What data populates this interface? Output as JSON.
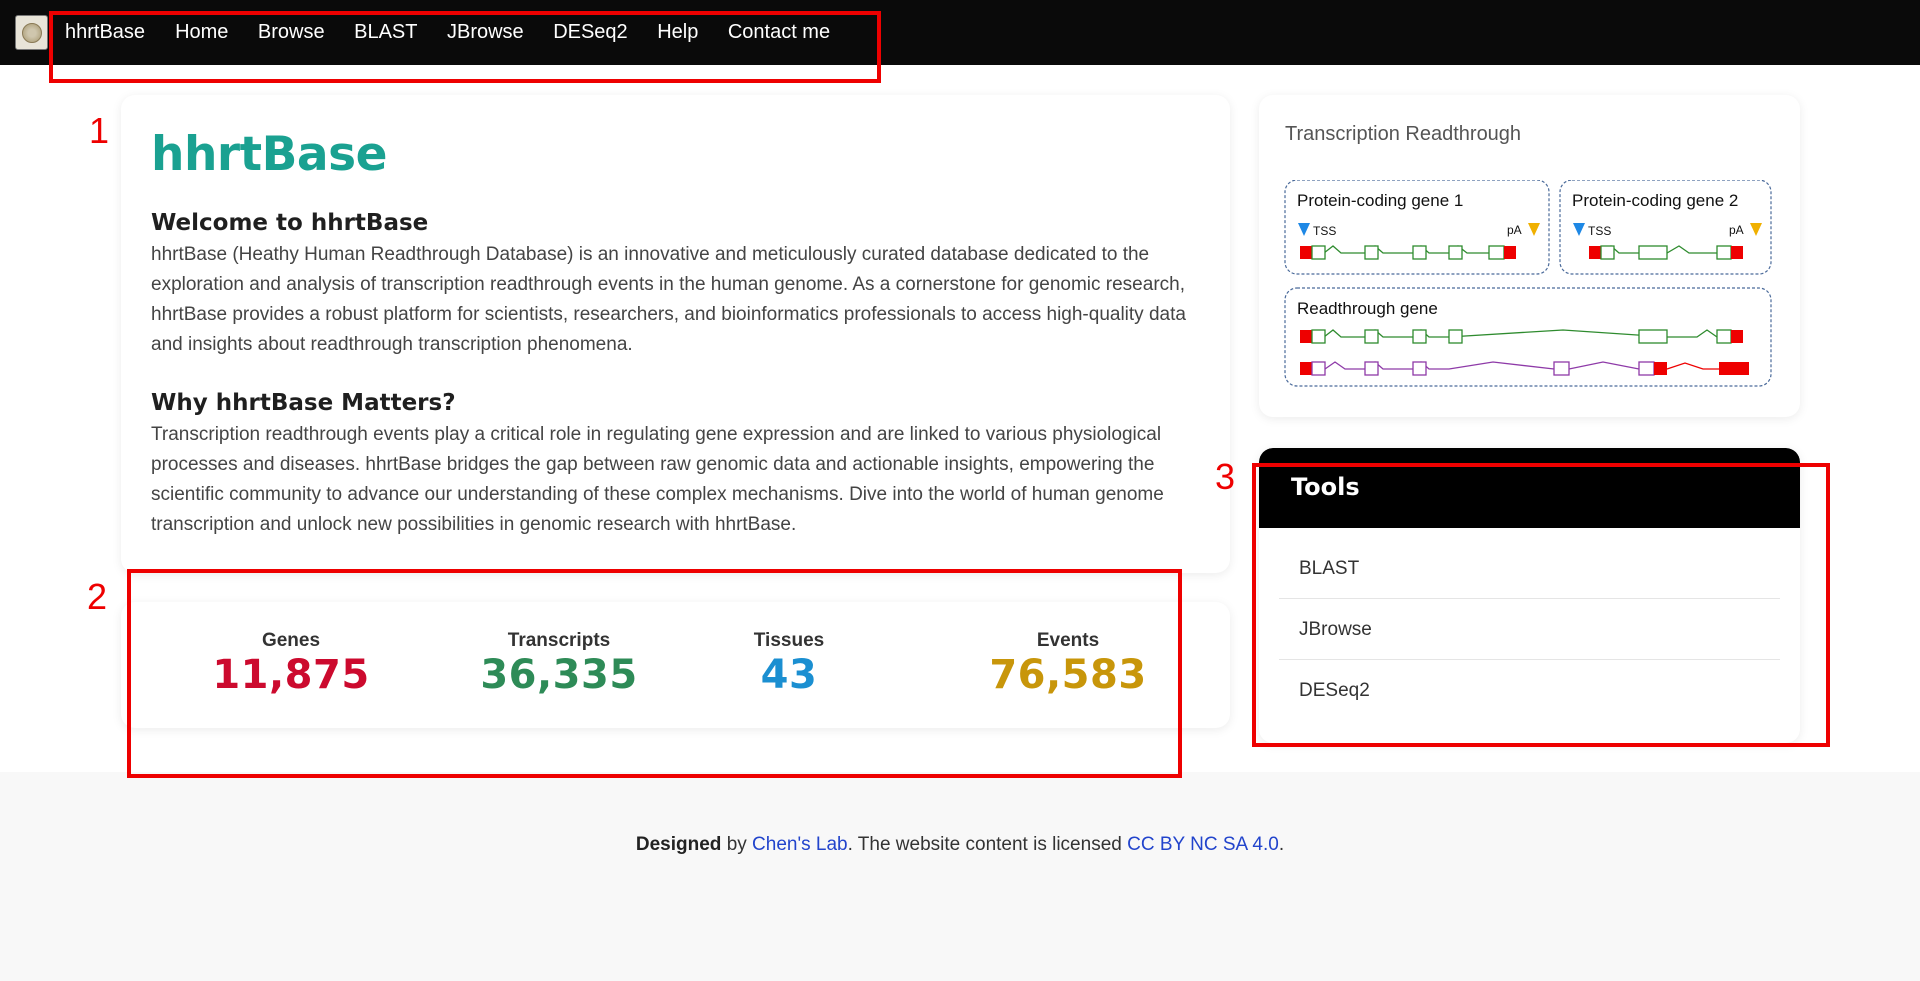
{
  "nav": {
    "logo_icon": "institution-emblem-icon",
    "items": [
      "hhrtBase",
      "Home",
      "Browse",
      "BLAST",
      "JBrowse",
      "DESeq2",
      "Help",
      "Contact me"
    ]
  },
  "annotations": [
    "1",
    "2",
    "3"
  ],
  "intro": {
    "title": "hhrtBase",
    "welcome_heading": "Welcome to hhrtBase",
    "welcome_text": "hhrtBase (Heathy Human Readthrough Database) is an innovative and meticulously curated database dedicated to the exploration and analysis of transcription readthrough events in the human genome. As a cornerstone for genomic research, hhrtBase provides a robust platform for scientists, researchers, and bioinformatics professionals to access high-quality data and insights about readthrough transcription phenomena.",
    "why_heading": "Why hhrtBase Matters?",
    "why_text": "Transcription readthrough events play a critical role in regulating gene expression and are linked to various physiological processes and diseases. hhrtBase bridges the gap between raw genomic data and actionable insights, empowering the scientific community to advance our understanding of these complex mechanisms. Dive into the world of human genome transcription and unlock new possibilities in genomic research with hhrtBase."
  },
  "stats": [
    {
      "label": "Genes",
      "value": "11,875",
      "color": "#cc0a2e"
    },
    {
      "label": "Transcripts",
      "value": "36,335",
      "color": "#2e8b57"
    },
    {
      "label": "Tissues",
      "value": "43",
      "color": "#1b8fd1"
    },
    {
      "label": "Events",
      "value": "76,583",
      "color": "#c8960a"
    }
  ],
  "diagram": {
    "title": "Transcription Readthrough",
    "gene1_label": "Protein-coding gene 1",
    "gene2_label": "Protein-coding gene 2",
    "readthrough_label": "Readthrough gene",
    "tss_label": "TSS",
    "pa_label": "pA"
  },
  "tools": {
    "heading": "Tools",
    "items": [
      "BLAST",
      "JBrowse",
      "DESeq2"
    ]
  },
  "footer": {
    "designed": "Designed",
    "by": " by ",
    "lab_link": "Chen's Lab",
    "license_text": ". The website content is licensed ",
    "license_link": "CC BY NC SA 4.0",
    "end": "."
  },
  "colors": {
    "accent_teal": "#1aa191",
    "link_blue": "#2244cc",
    "annotation_red": "#ee0000"
  }
}
